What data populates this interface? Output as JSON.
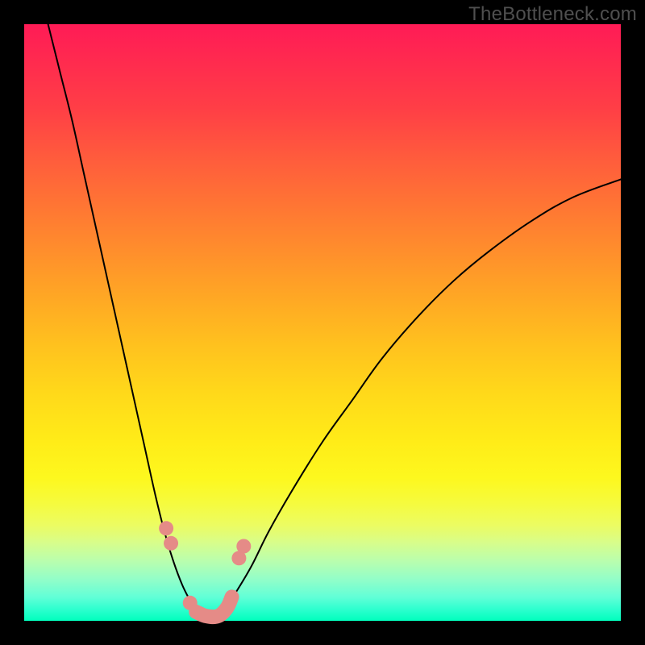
{
  "watermark": "TheBottleneck.com",
  "colors": {
    "gradient_top": "#ff1b56",
    "gradient_bottom": "#00ffbd",
    "curve": "#000000",
    "markers": "#e58b87",
    "frame": "#000000"
  },
  "chart_data": {
    "type": "line",
    "title": "",
    "xlabel": "",
    "ylabel": "",
    "xlim": [
      0,
      100
    ],
    "ylim": [
      0,
      100
    ],
    "grid": false,
    "legend": null,
    "series": [
      {
        "name": "left-branch",
        "x": [
          4,
          6,
          8,
          10,
          12,
          14,
          16,
          18,
          20,
          22,
          23.5,
          25,
          26.5,
          28,
          29
        ],
        "y": [
          100,
          92,
          84,
          75,
          66,
          57,
          48,
          39,
          30,
          21,
          15,
          10,
          6,
          3,
          1
        ]
      },
      {
        "name": "right-branch",
        "x": [
          33,
          35,
          38,
          41,
          45,
          50,
          55,
          60,
          66,
          72,
          78,
          85,
          92,
          100
        ],
        "y": [
          1,
          4,
          9,
          15,
          22,
          30,
          37,
          44,
          51,
          57,
          62,
          67,
          71,
          74
        ]
      },
      {
        "name": "valley-floor",
        "x": [
          29,
          31,
          33
        ],
        "y": [
          1,
          0.5,
          1
        ]
      }
    ],
    "markers": [
      {
        "name": "left-upper-pair",
        "points": [
          {
            "x": 23.8,
            "y": 15.5
          },
          {
            "x": 24.6,
            "y": 13.0
          }
        ]
      },
      {
        "name": "left-lower",
        "points": [
          {
            "x": 27.8,
            "y": 3.0
          }
        ]
      },
      {
        "name": "valley-worm",
        "points": [
          {
            "x": 28.8,
            "y": 1.5
          },
          {
            "x": 30.5,
            "y": 0.8
          },
          {
            "x": 32.5,
            "y": 0.8
          },
          {
            "x": 34.0,
            "y": 2.2
          },
          {
            "x": 34.8,
            "y": 4.0
          }
        ]
      },
      {
        "name": "right-upper-pair",
        "points": [
          {
            "x": 36.0,
            "y": 10.5
          },
          {
            "x": 36.8,
            "y": 12.5
          }
        ]
      }
    ]
  }
}
